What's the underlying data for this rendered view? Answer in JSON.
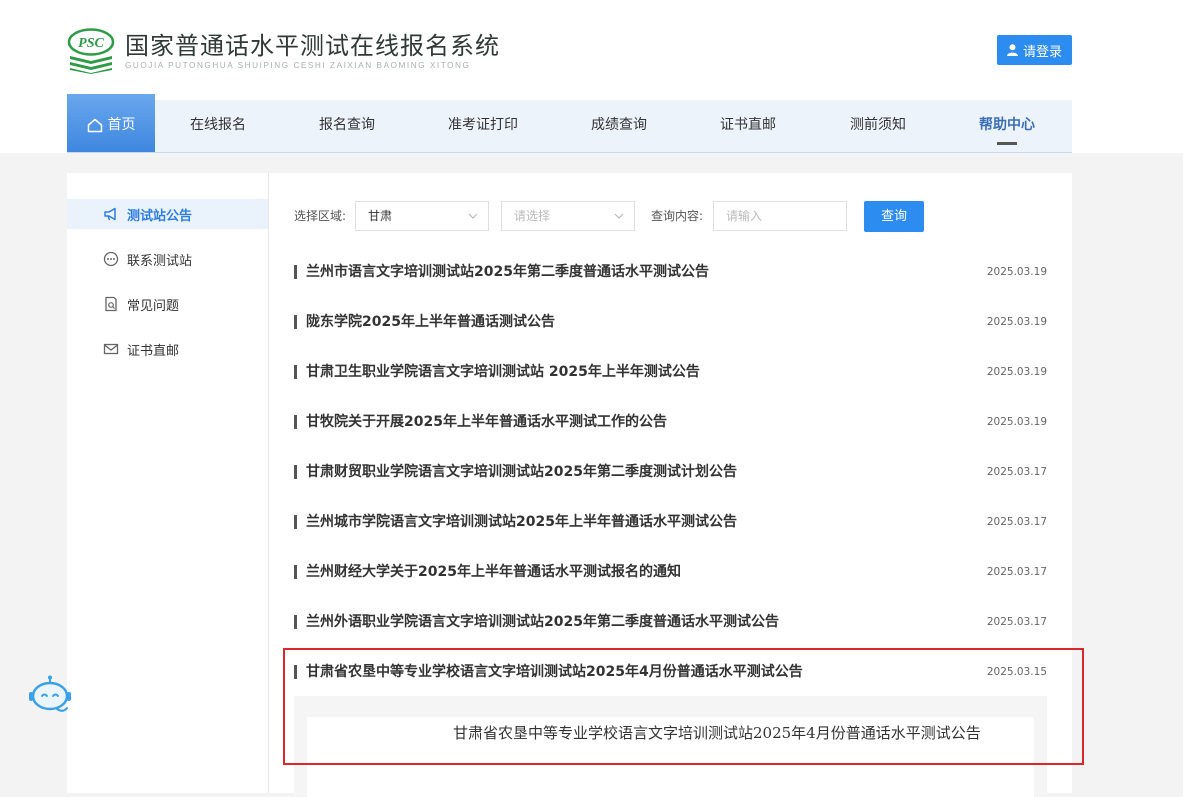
{
  "brand": {
    "logo_letters": "PSC",
    "title": "国家普通话水平测试在线报名系统",
    "subtitle": "GUOJIA PUTONGHUA SHUIPING CESHI ZAIXIAN BAOMING XITONG",
    "accent_color": "#2d8cf0",
    "logo_color": "#2e9b47"
  },
  "header": {
    "login_label": "请登录",
    "login_icon": "user-icon"
  },
  "nav": {
    "items": [
      {
        "label": "首页",
        "icon": "home-icon"
      },
      {
        "label": "在线报名"
      },
      {
        "label": "报名查询"
      },
      {
        "label": "准考证打印"
      },
      {
        "label": "成绩查询"
      },
      {
        "label": "证书直邮"
      },
      {
        "label": "测前须知"
      },
      {
        "label": "帮助中心"
      }
    ]
  },
  "sidebar": {
    "items": [
      {
        "label": "测试站公告",
        "icon": "megaphone-icon"
      },
      {
        "label": "联系测试站",
        "icon": "chat-icon"
      },
      {
        "label": "常见问题",
        "icon": "document-search-icon"
      },
      {
        "label": "证书直邮",
        "icon": "mail-icon"
      }
    ]
  },
  "filter": {
    "region_label": "选择区域:",
    "region_value": "甘肃",
    "second_placeholder": "请选择",
    "query_label": "查询内容:",
    "query_placeholder": "请输入",
    "search_button": "查询"
  },
  "announcements": [
    {
      "title": "兰州市语言文字培训测试站2025年第二季度普通话水平测试公告",
      "date": "2025.03.19"
    },
    {
      "title": "陇东学院2025年上半年普通话测试公告",
      "date": "2025.03.19"
    },
    {
      "title": "甘肃卫生职业学院语言文字培训测试站 2025年上半年测试公告",
      "date": "2025.03.19"
    },
    {
      "title": "甘牧院关于开展2025年上半年普通话水平测试工作的公告",
      "date": "2025.03.19"
    },
    {
      "title": "甘肃财贸职业学院语言文字培训测试站2025年第二季度测试计划公告",
      "date": "2025.03.17"
    },
    {
      "title": "兰州城市学院语言文字培训测试站2025年上半年普通话水平测试公告",
      "date": "2025.03.17"
    },
    {
      "title": "兰州财经大学关于2025年上半年普通话水平测试报名的通知",
      "date": "2025.03.17"
    },
    {
      "title": "兰州外语职业学院语言文字培训测试站2025年第二季度普通话水平测试公告",
      "date": "2025.03.17"
    },
    {
      "title": "甘肃省农垦中等专业学校语言文字培训测试站2025年4月份普通话水平测试公告",
      "date": "2025.03.15"
    }
  ],
  "detail": {
    "text": "甘肃省农垦中等专业学校语言文字培训测试站2025年4月份普通话水平测试公告"
  },
  "assistant": {
    "icon": "robot-assistant-icon"
  }
}
